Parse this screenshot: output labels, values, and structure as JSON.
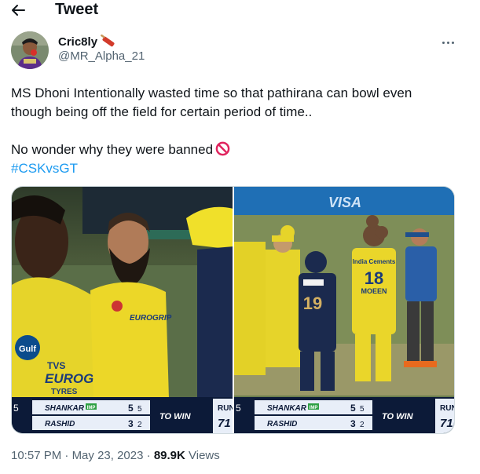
{
  "header": {
    "title": "Tweet"
  },
  "author": {
    "display_name": "Cric8ly",
    "handle": "@MR_Alpha_21"
  },
  "tweet": {
    "line1": "MS Dhoni Intentionally wasted time so that pathirana can bowl even",
    "line2": "though being off the field for certain period of time..",
    "line3": "No wonder why they were banned",
    "hashtag": "#CSKvsGT"
  },
  "media": {
    "left": {
      "jersey_text": "EUROGRIP TYRES",
      "chest_text": "TVS",
      "score_player1": "SHANKAR",
      "score_player1_badge": "IMP",
      "score_player1_val": "5",
      "score_player1_balls": "5",
      "score_player2": "RASHID",
      "score_player2_val": "3",
      "score_player2_balls": "2",
      "to_win": "TO WIN",
      "runs_label": "RUN",
      "runs_val": "71",
      "edge_num": "5"
    },
    "right": {
      "jersey_number": "18",
      "jersey_name": "MOEEN",
      "gt_number": "19",
      "score_player1": "SHANKAR",
      "score_player1_badge": "IMP",
      "score_player1_val": "5",
      "score_player1_balls": "5",
      "score_player2": "RASHID",
      "score_player2_val": "3",
      "score_player2_balls": "2",
      "to_win": "TO WIN",
      "runs_label": "RUN",
      "runs_val": "71",
      "edge_num": "5"
    }
  },
  "meta": {
    "time": "10:57 PM",
    "separator": "·",
    "date": "May 23, 2023",
    "views_count": "89.9K",
    "views_label": "Views"
  },
  "colors": {
    "link": "#1d9bf0",
    "text": "#0f1419",
    "muted": "#536471",
    "csk_yellow": "#f2e21c",
    "gt_navy": "#1b2a4e"
  },
  "icons": {
    "back": "arrow-left-icon",
    "more": "more-dots-icon",
    "bat": "cricket-bat-icon",
    "banned": "prohibited-icon"
  }
}
